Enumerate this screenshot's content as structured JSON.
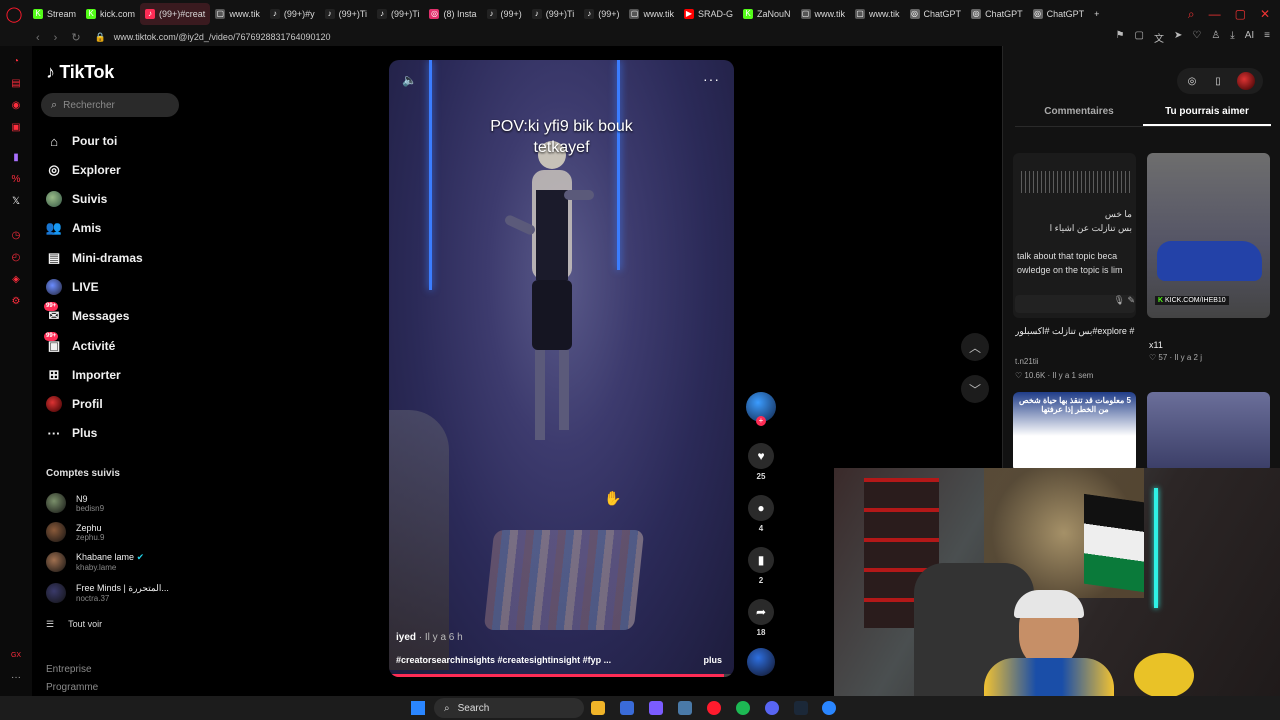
{
  "browser": {
    "tabs": [
      {
        "label": "Stream",
        "fav": "K",
        "color": "#53fc18"
      },
      {
        "label": "kick.com",
        "fav": "K",
        "color": "#53fc18"
      },
      {
        "label": "(99+)#creat",
        "fav": "♪",
        "color": "#fe2c55",
        "active": true
      },
      {
        "label": "www.tik",
        "fav": "▢",
        "color": "#555"
      },
      {
        "label": "(99+)#y",
        "fav": "♪",
        "color": "#222"
      },
      {
        "label": "(99+)Ti",
        "fav": "♪",
        "color": "#222"
      },
      {
        "label": "(99+)Ti",
        "fav": "♪",
        "color": "#222"
      },
      {
        "label": "(8) Insta",
        "fav": "◎",
        "color": "#e1306c"
      },
      {
        "label": "(99+)",
        "fav": "♪",
        "color": "#222"
      },
      {
        "label": "(99+)Ti",
        "fav": "♪",
        "color": "#222"
      },
      {
        "label": "(99+)",
        "fav": "♪",
        "color": "#222"
      },
      {
        "label": "www.tik",
        "fav": "▢",
        "color": "#555"
      },
      {
        "label": "SRAD-G",
        "fav": "▶",
        "color": "#ff0000"
      },
      {
        "label": "ZaNouN",
        "fav": "K",
        "color": "#53fc18"
      },
      {
        "label": "www.tik",
        "fav": "▢",
        "color": "#555"
      },
      {
        "label": "www.tik",
        "fav": "▢",
        "color": "#555"
      },
      {
        "label": "ChatGPT",
        "fav": "◎",
        "color": "#666"
      },
      {
        "label": "ChatGPT",
        "fav": "◎",
        "color": "#666"
      },
      {
        "label": "ChatGPT",
        "fav": "◎",
        "color": "#666"
      }
    ],
    "url": "www.tiktok.com/@iy2d_/video/7676928831764090120"
  },
  "tiktok": {
    "logo": "TikTok",
    "search_placeholder": "Rechercher",
    "nav": [
      {
        "label": "Pour toi",
        "icon": "home-icon",
        "glyph": "⌂"
      },
      {
        "label": "Explorer",
        "icon": "compass-icon",
        "glyph": "◎"
      },
      {
        "label": "Suivis",
        "icon": "following-avatar-icon",
        "glyph": ""
      },
      {
        "label": "Amis",
        "icon": "friends-icon",
        "glyph": "👥"
      },
      {
        "label": "Mini-dramas",
        "icon": "mini-dramas-icon",
        "glyph": "▤"
      },
      {
        "label": "LIVE",
        "icon": "live-avatar-icon",
        "glyph": ""
      },
      {
        "label": "Messages",
        "icon": "messages-icon",
        "glyph": "✉",
        "badge": "99+"
      },
      {
        "label": "Activité",
        "icon": "activity-icon",
        "glyph": "▣",
        "badge": "99+"
      },
      {
        "label": "Importer",
        "icon": "upload-icon",
        "glyph": "⊞"
      },
      {
        "label": "Profil",
        "icon": "profile-avatar-icon",
        "glyph": ""
      },
      {
        "label": "Plus",
        "icon": "more-icon",
        "glyph": "···"
      }
    ],
    "following_title": "Comptes suivis",
    "accounts": [
      {
        "name": "N9",
        "handle": "bedisn9",
        "color": "#7a8f6a"
      },
      {
        "name": "Zephu",
        "handle": "zephu.9",
        "color": "#8a5a3a"
      },
      {
        "name": "Khabane lame",
        "handle": "khaby.lame",
        "color": "#a07050",
        "verified": true
      },
      {
        "name": "Free Minds | المتحررة...",
        "handle": "noctra.37",
        "color": "#3a3a6a"
      }
    ],
    "see_all": "Tout voir",
    "footer": [
      "Entreprise",
      "Programme"
    ]
  },
  "video": {
    "caption": "POV:ki yfi9 bik bouk tetkayef",
    "author": "iyed",
    "time": " · Il y a 6 h",
    "tags": "#creatorsearchinsights #createsightinsight #fyp ...",
    "more": "plus",
    "progress": 0.97,
    "likes": "25",
    "comments": "4",
    "saves": "2",
    "shares": "18"
  },
  "right_panel": {
    "tabs": [
      "Commentaires",
      "Tu pourrais aimer"
    ],
    "active_tab": 1,
    "thumb1_lines": [
      "ما خس",
      "بس تنازلت عن اشياء ا"
    ],
    "thumb1_en": [
      "talk about that topic beca",
      "owledge on the topic is lim"
    ],
    "item1_title": "بس تنازلت #اكسبلور#explore #بيانك_والفولو_والاكسبلوريا_مرحبه",
    "item1_user": "t.n21tii",
    "item1_stats": "♡ 10.6K · Il y a 1 sem",
    "item2_title": "x11",
    "item2_stats": "♡ 57 · Il y a 2 j",
    "kick_label": "KICK.COM/IHEB10",
    "thumb3_title": "5 معلومات قد تنقذ بها حياة شخص من الخطر إذا عرفتها"
  },
  "taskbar": {
    "search_label": "Search"
  }
}
